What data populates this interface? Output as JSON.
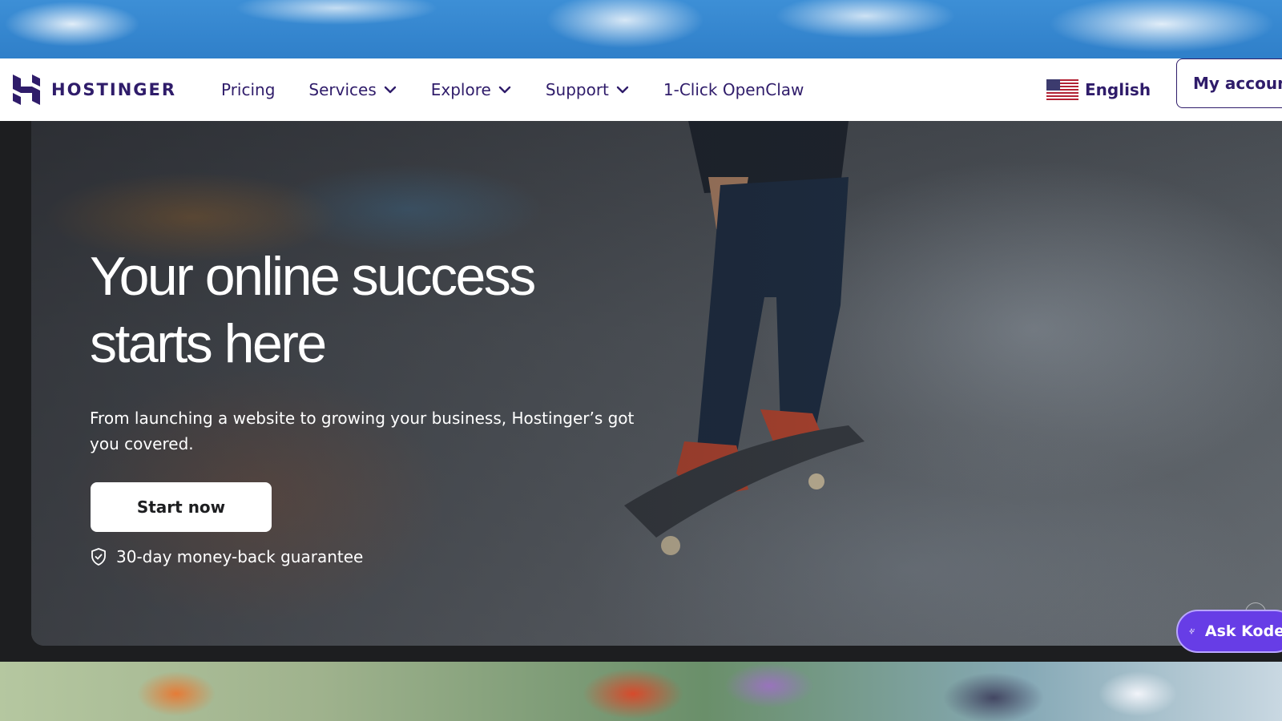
{
  "brand": {
    "name": "HOSTINGER",
    "logo_icon": "hostinger-h-icon",
    "color": "#2f1c6a"
  },
  "nav": {
    "items": [
      {
        "label": "Pricing",
        "dropdown": false
      },
      {
        "label": "Services",
        "dropdown": true
      },
      {
        "label": "Explore",
        "dropdown": true
      },
      {
        "label": "Support",
        "dropdown": true
      },
      {
        "label": "1-Click OpenClaw",
        "dropdown": false
      }
    ],
    "language": {
      "label": "English",
      "flag_icon": "us-flag-icon"
    },
    "account_button": "My account"
  },
  "hero": {
    "title_line1": "Your online success",
    "title_line2": "starts here",
    "subtitle": "From launching a website to growing your business, Hostinger’s got you covered.",
    "cta_label": "Start now",
    "guarantee": "30-day money-back guarantee",
    "guarantee_icon": "shield-check-icon"
  },
  "assistant": {
    "label": "Ask Kodee",
    "icon": "sparkle-icon",
    "accent": "#673de6"
  }
}
